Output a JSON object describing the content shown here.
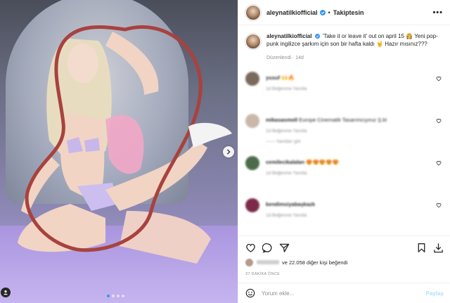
{
  "post": {
    "username": "aleynatilkiofficial",
    "follow_label": "Takiptesin",
    "separator": "•",
    "more_label": "•••",
    "caption_text": "'Take it or leave it' out on april 15 👸 Yeni pop-punk ingilizce şarkım için son bir hafta kaldı 🤘 Hazır mısınız???",
    "caption_meta": "Düzenlendi · 14d"
  },
  "comments": [
    {
      "user": "yusuf",
      "text": "🙌🔥",
      "meta": "1d   Beğenme   Yanıtla",
      "reply": "",
      "avatar_color": "#7a6a5c"
    },
    {
      "user": "mikasasmoll",
      "text": "Europe Cinematik Tasarımcıyınız Ş.kt",
      "meta": "1d   Beğenme   Yanıtla",
      "reply": "——   Yanıtları gör",
      "avatar_color": "#c9b7a9"
    },
    {
      "user": "cemilecikalalan",
      "text": "😍😍😍😍😍",
      "meta": "1d   Beğenme   Yanıtla",
      "reply": "",
      "avatar_color": "#4c6b4a"
    },
    {
      "user": "kendimsiyabaşkazk",
      "text": "",
      "meta": "1d   Beğenme   Yanıtla",
      "reply": "",
      "avatar_color": "#7b2a4a"
    }
  ],
  "likes": {
    "suffix": "ve 22.058 diğer kişi beğendi"
  },
  "timestamp": "37 DAKİKA ÖNCE",
  "add_comment": {
    "placeholder": "Yorum ekle...",
    "post_label": "Paylaş"
  },
  "colors": {
    "link_blue": "#3897f0",
    "disabled_blue": "#b2dffc",
    "muted": "#8e8e8e"
  },
  "carousel": {
    "current": 1,
    "total": 4
  }
}
